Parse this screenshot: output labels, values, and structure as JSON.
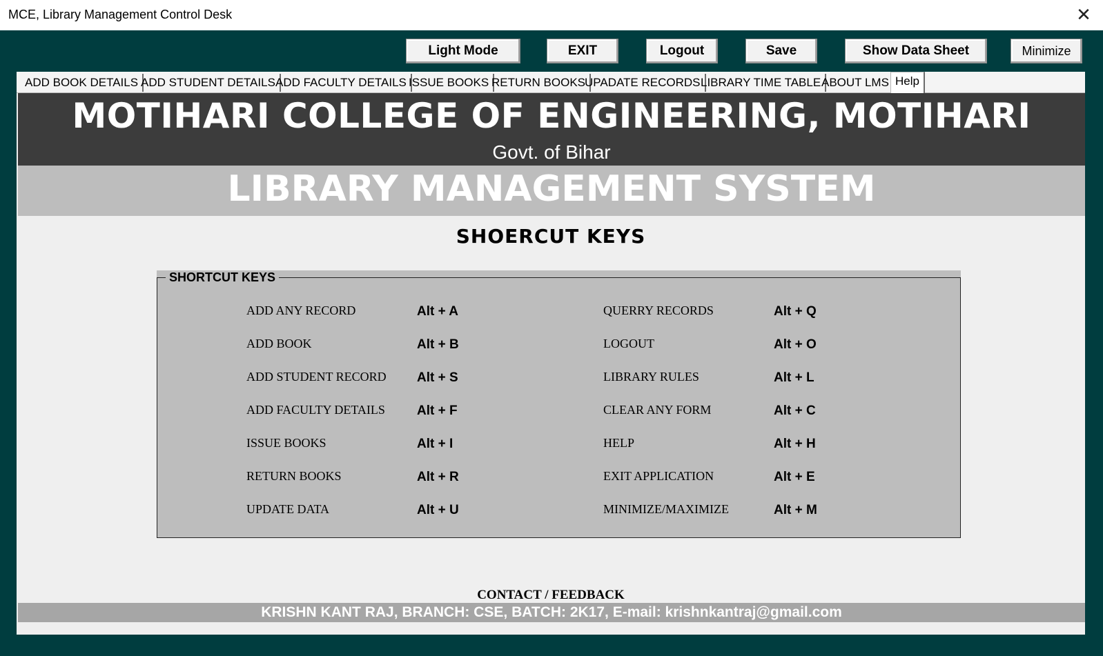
{
  "window": {
    "title": "MCE, Library Management Control Desk",
    "close_glyph": "✕"
  },
  "toolbar": {
    "light_mode": "Light Mode",
    "exit": "EXIT",
    "logout": "Logout",
    "save": "Save",
    "show_data_sheet": "Show Data Sheet",
    "minimize": "Minimize"
  },
  "tabs": [
    {
      "label": "ADD BOOK DETAILS"
    },
    {
      "label": "ADD STUDENT DETAILS"
    },
    {
      "label": "ADD FACULTY DETAILS"
    },
    {
      "label": "ISSUE BOOKS"
    },
    {
      "label": "RETURN BOOKS"
    },
    {
      "label": "UPADATE RECORDS"
    },
    {
      "label": "LIBRARY TIME TABLE"
    },
    {
      "label": "ABOUT LMS"
    },
    {
      "label": "Help"
    }
  ],
  "header": {
    "college": "MOTIHARI COLLEGE OF ENGINEERING, MOTIHARI",
    "govt": "Govt. of Bihar",
    "system": "LIBRARY MANAGEMENT SYSTEM"
  },
  "page": {
    "heading": "SHOERCUT KEYS",
    "group_title": "SHORTCUT KEYS"
  },
  "shortcuts_left": [
    {
      "label": "ADD ANY RECORD",
      "key": "Alt + A"
    },
    {
      "label": "ADD BOOK",
      "key": "Alt + B"
    },
    {
      "label": "ADD STUDENT RECORD",
      "key": "Alt + S"
    },
    {
      "label": "ADD FACULTY DETAILS",
      "key": "Alt + F"
    },
    {
      "label": "ISSUE BOOKS",
      "key": "Alt + I"
    },
    {
      "label": "RETURN BOOKS",
      "key": "Alt + R"
    },
    {
      "label": "UPDATE DATA",
      "key": "Alt + U"
    }
  ],
  "shortcuts_right": [
    {
      "label": "QUERRY RECORDS",
      "key": "Alt + Q"
    },
    {
      "label": "LOGOUT",
      "key": "Alt + O"
    },
    {
      "label": "LIBRARY RULES",
      "key": "Alt + L"
    },
    {
      "label": "CLEAR ANY FORM",
      "key": "Alt + C"
    },
    {
      "label": "HELP",
      "key": "Alt + H"
    },
    {
      "label": "EXIT APPLICATION",
      "key": "Alt + E"
    },
    {
      "label": "MINIMIZE/MAXIMIZE",
      "key": "Alt + M"
    }
  ],
  "footer": {
    "contact_title": "CONTACT / FEEDBACK",
    "contact_info": "KRISHN KANT RAJ, BRANCH: CSE, BATCH: 2K17, E-mail: krishnkantraj@gmail.com"
  },
  "colors": {
    "frame": "#003d3f",
    "banner_dark": "#3c3c3c",
    "banner_light": "#bdbdbd",
    "groupbox": "#bdbdbd",
    "footer_bar": "#a6a6a6"
  }
}
